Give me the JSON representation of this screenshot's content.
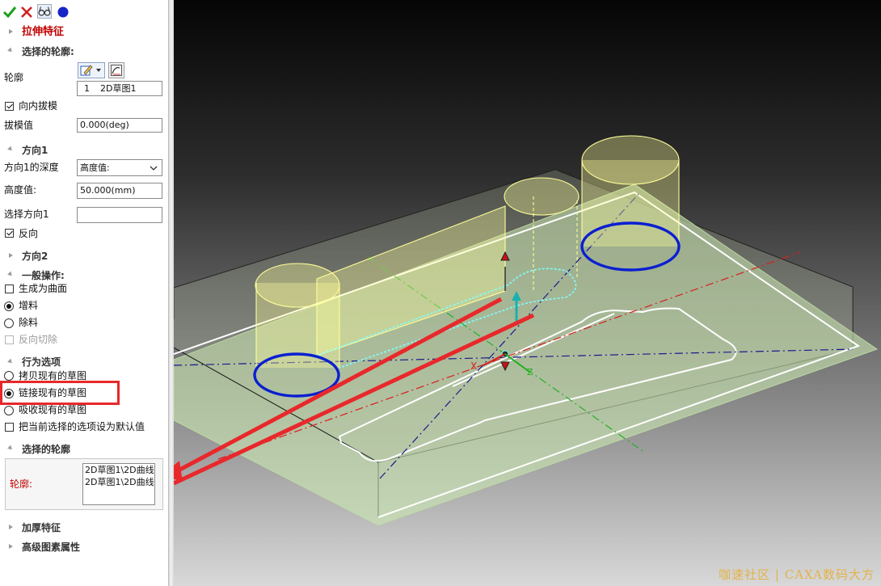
{
  "toolbar": {
    "ok_icon": "check-icon",
    "cancel_icon": "close-icon",
    "preview_icon": "glasses-icon",
    "color_icon": "blue-dot-icon"
  },
  "feature_title": "拉伸特征",
  "selected_profile": {
    "section_label": "选择的轮廓:",
    "profile_label": "轮廓",
    "list_item_index": "1",
    "list_item_name": "2D草图1"
  },
  "draft_inward": {
    "label": "向内拔模",
    "checked": true
  },
  "draft_value": {
    "label": "拔模值",
    "value": "0.000(deg)"
  },
  "direction1": {
    "section_label": "方向1",
    "depth_label": "方向1的深度",
    "depth_option": "高度值:",
    "height_label": "高度值:",
    "height_value": "50.000(mm)",
    "select_dir_label": "选择方向1",
    "reverse_label": "反向",
    "reverse_checked": true
  },
  "direction2": {
    "section_label": "方向2"
  },
  "general_ops": {
    "section_label": "一般操作:",
    "make_surface_label": "生成为曲面",
    "add_label": "增料",
    "remove_label": "除料",
    "reverse_cut_label": "反向切除",
    "selected": "增料"
  },
  "behavior": {
    "section_label": "行为选项",
    "copy_sketch_label": "拷贝现有的草图",
    "link_sketch_label": "链接现有的草图",
    "absorb_sketch_label": "吸收现有的草图",
    "set_default_label": "把当前选择的选项设为默认值",
    "selected": "链接现有的草图"
  },
  "selected_profile2": {
    "section_label": "选择的轮廓",
    "profile_label": "轮廓:",
    "items": [
      "2D草图1\\2D曲线",
      "2D草图1\\2D曲线"
    ]
  },
  "thicken": {
    "section_label": "加厚特征"
  },
  "advanced": {
    "section_label": "高级图素属性"
  },
  "viewport": {
    "axis_x_label": "X",
    "axis_z_label": "Z",
    "watermark": "咖速社区 | CAXA数码大方"
  },
  "colors": {
    "highlight_red": "#e8282b",
    "profile_blue": "#0b1fd0",
    "extrude_yellow": "#fffe9a",
    "plate_green": "#c9e7b0"
  }
}
